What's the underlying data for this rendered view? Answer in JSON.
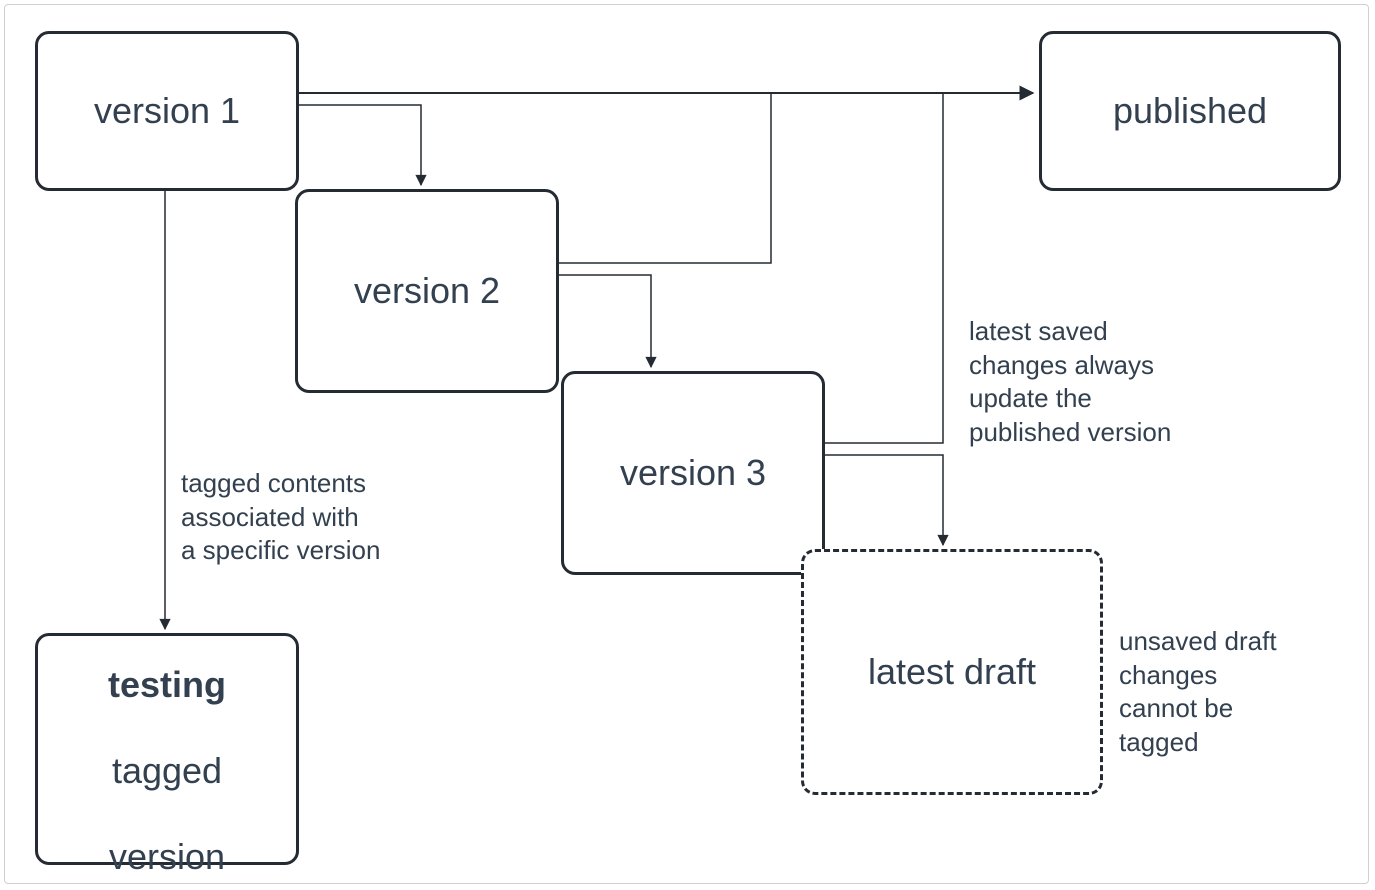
{
  "nodes": {
    "version1": "version 1",
    "version2": "version 2",
    "version3": "version 3",
    "published": "published",
    "latestDraft": "latest draft",
    "testing_line1": "testing",
    "testing_line2": "tagged",
    "testing_line3": "version"
  },
  "annotations": {
    "taggedContents": "tagged contents\nassociated with\na specific version",
    "latestSaved": "latest saved\nchanges always\nupdate the\npublished version",
    "unsavedDraft": "unsaved draft\nchanges\ncannot be\ntagged"
  },
  "edges": [
    {
      "from": "version1",
      "to": "version2"
    },
    {
      "from": "version2",
      "to": "version3"
    },
    {
      "from": "version1",
      "to": "published"
    },
    {
      "from": "version2",
      "to": "published"
    },
    {
      "from": "version3",
      "to": "published"
    },
    {
      "from": "version3",
      "to": "latestDraft"
    },
    {
      "from": "version1",
      "to": "testingTagged"
    }
  ],
  "colors": {
    "nodeBorder": "#252b33",
    "text": "#33404f",
    "edge": "#252b33"
  }
}
